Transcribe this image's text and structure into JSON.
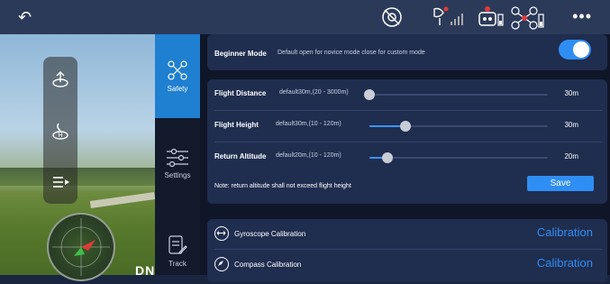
{
  "topbar": {
    "back_icon": "back-arrow-icon",
    "icons": [
      "gimbal-off-icon",
      "signal-icon",
      "robot-battery-icon",
      "drone-battery-icon"
    ],
    "more": "•••"
  },
  "camera": {
    "osd_text": "DN"
  },
  "left_tools": [
    "takeoff-icon",
    "return-home-icon",
    "playlist-icon"
  ],
  "tabs": [
    {
      "label": "Safety",
      "icon": "drone-icon",
      "active": true
    },
    {
      "label": "Settings",
      "icon": "sliders-icon",
      "active": false
    },
    {
      "label": "Track",
      "icon": "track-doc-icon",
      "active": false
    }
  ],
  "beginner": {
    "label": "Beginner Mode",
    "hint": "Default open for novice mode close for custom mode",
    "enabled": true
  },
  "limits": [
    {
      "label": "Flight Distance",
      "hint": "default30m,(20 - 3000m)",
      "value": "30m",
      "fraction": 0.0
    },
    {
      "label": "Flight Height",
      "hint": "default30m,(10 - 120m)",
      "value": "30m",
      "fraction": 0.2
    },
    {
      "label": "Return Altitude",
      "hint": "default20m,(10 - 120m)",
      "value": "20m",
      "fraction": 0.1
    }
  ],
  "note": "Note: return altitude shall not exceed flight height",
  "save_label": "Save",
  "calibrations": [
    {
      "label": "Gyroscope Calibration",
      "icon": "gyroscope-icon",
      "button": "Calibration"
    },
    {
      "label": "Compass Calibration",
      "icon": "compass-icon",
      "button": "Calibration"
    }
  ],
  "colors": {
    "accent": "#2f8ef3",
    "card": "#1f2d4f",
    "topbar": "#2c3a5a"
  }
}
